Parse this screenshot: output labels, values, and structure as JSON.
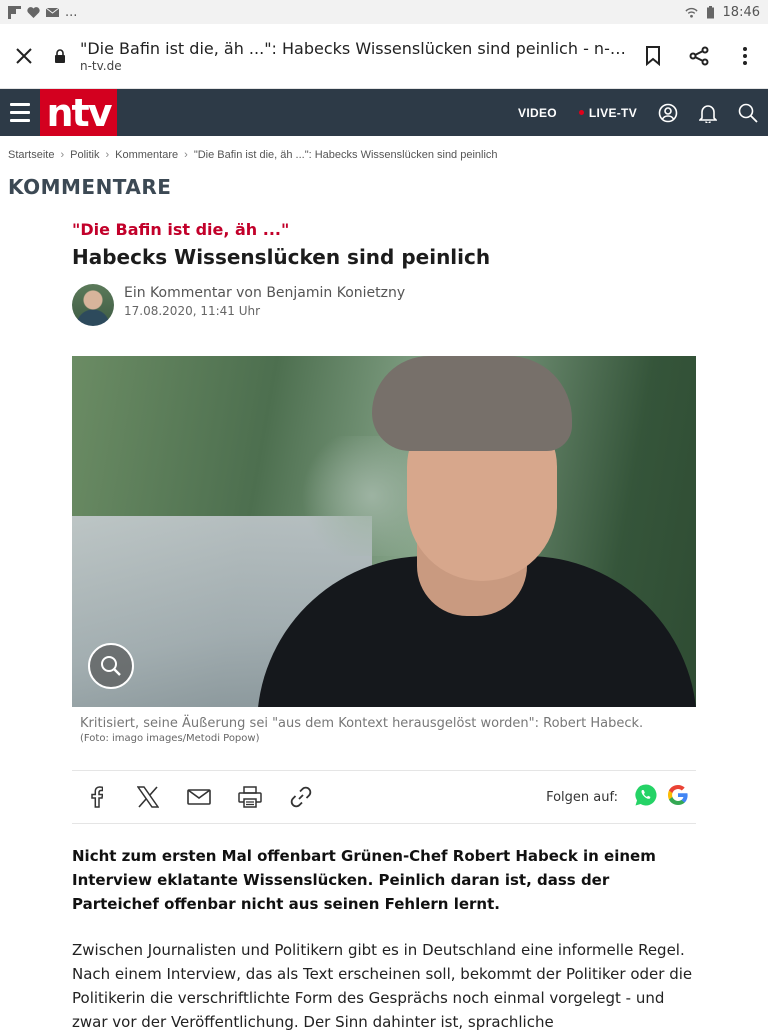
{
  "statusbar": {
    "time": "18:46",
    "ellipsis": "..."
  },
  "urlbar": {
    "page_title": "\"Die Bafin ist die, äh ...\": Habecks Wissenslücken sind peinlich - n-tv.de",
    "domain": "n-tv.de"
  },
  "nav": {
    "logo": "ntv",
    "video": "VIDEO",
    "live": "LIVE-TV"
  },
  "breadcrumb": {
    "items": [
      "Startseite",
      "Politik",
      "Kommentare",
      "\"Die Bafin ist die, äh ...\": Habecks Wissenslücken sind peinlich"
    ],
    "sep": "›"
  },
  "section": {
    "title": "KOMMENTARE"
  },
  "article": {
    "kicker": "\"Die Bafin ist die, äh ...\"",
    "headline": "Habecks Wissenslücken sind peinlich",
    "author": "Ein Kommentar von Benjamin Konietzny",
    "date": "17.08.2020, 11:41 Uhr",
    "caption": "Kritisiert, seine Äußerung sei \"aus dem Kontext herausgelöst worden\": Robert Habeck.",
    "credit": "(Foto: imago images/Metodi Popow)",
    "follow_label": "Folgen auf:",
    "lead": "Nicht zum ersten Mal offenbart Grünen-Chef Robert Habeck in einem Interview eklatante Wissenslücken. Peinlich daran ist, dass der Parteichef offenbar nicht aus seinen Fehlern lernt.",
    "body": "Zwischen Journalisten und Politikern gibt es in Deutschland eine informelle Regel. Nach einem Interview, das als Text erscheinen soll, bekommt der Politiker oder die Politikerin die verschriftlichte Form des Gesprächs noch einmal vorgelegt - und zwar vor der Veröffentlichung. Der Sinn dahinter ist, sprachliche"
  },
  "colors": {
    "ntv_red": "#d3001f",
    "nav_bg": "#2d3a47",
    "kicker": "#c2002a"
  },
  "icons": [
    "close-icon",
    "lock-icon",
    "bookmark-icon",
    "share-icon",
    "more-icon",
    "user-icon",
    "bell-icon",
    "search-icon",
    "zoom-icon",
    "facebook-icon",
    "x-icon",
    "mail-icon",
    "print-icon",
    "link-icon",
    "whatsapp-icon",
    "google-icon"
  ]
}
